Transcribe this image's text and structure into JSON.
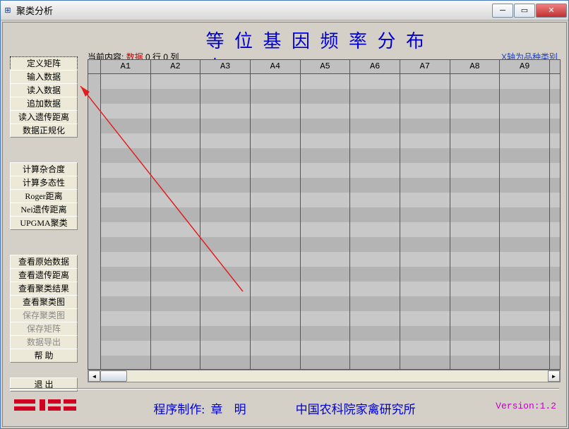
{
  "window": {
    "title": "聚类分析"
  },
  "buttons": {
    "g1": [
      "定义矩阵",
      "输入数据",
      "读入数据",
      "追加数据",
      "读入遗传距离",
      "数据正规化"
    ],
    "g2": [
      "计算杂合度",
      "计算多态性",
      "Roger距离",
      "Nei遗传距离",
      "UPGMA聚类"
    ],
    "g3": [
      "查看原始数据",
      "查看遗传距离",
      "查看聚类结果",
      "查看聚类图",
      "保存聚类图",
      "保存矩阵",
      "数据导出",
      "帮  助"
    ],
    "g3_disabled": [
      false,
      false,
      false,
      false,
      true,
      true,
      true,
      false
    ],
    "exit": "退  出"
  },
  "header": {
    "title": "等 位 基 因 频 率 分 布 表",
    "status_prefix": "当前内容:",
    "status_value": "数据",
    "dims": "    0 行 0 列",
    "xaxis": "X轴为品种类别"
  },
  "columns": [
    "A1",
    "A2",
    "A3",
    "A4",
    "A5",
    "A6",
    "A7",
    "A8",
    "A9"
  ],
  "footer": {
    "credit_label": "程序制作:",
    "credit_name": "章  明",
    "org": "中国农科院家禽研究所",
    "version": "Version:1.2"
  }
}
